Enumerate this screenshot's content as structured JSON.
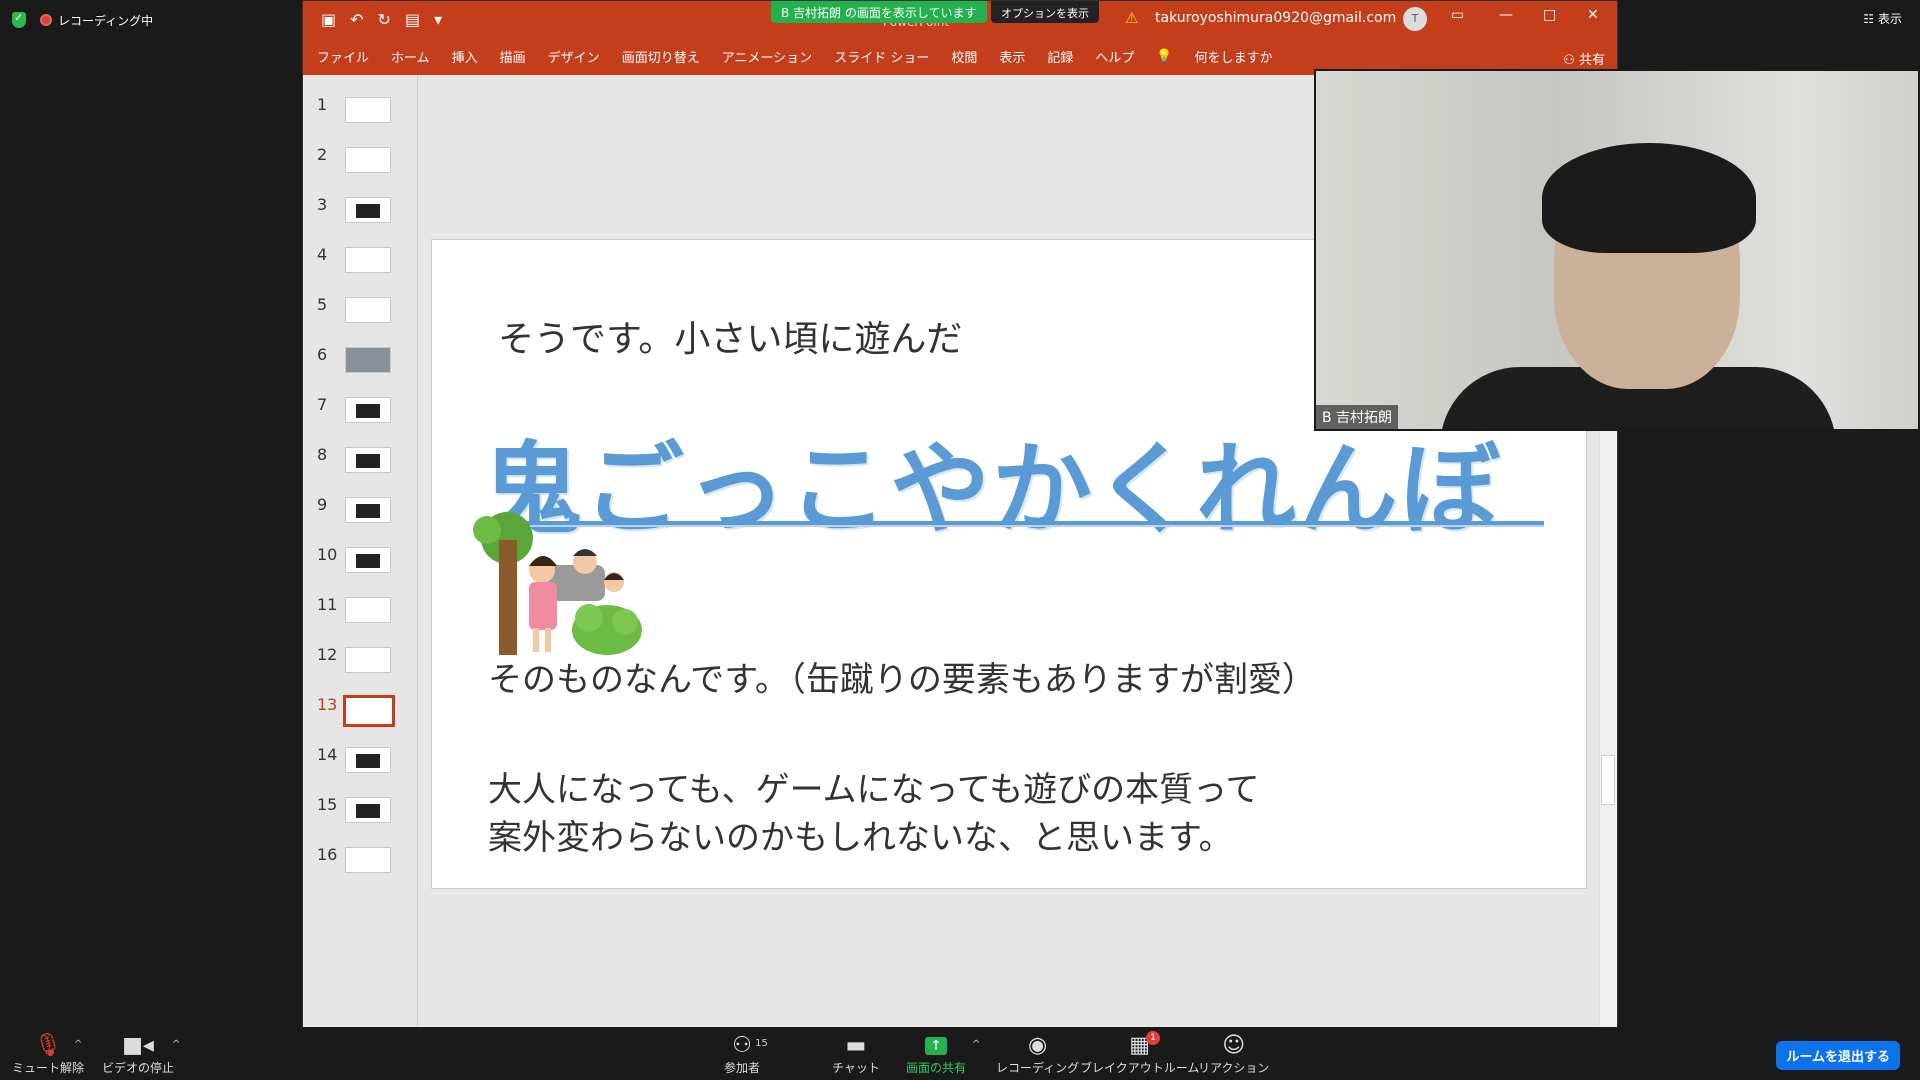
{
  "zoom": {
    "recording_label": "レコーディング中",
    "view_label": "表示",
    "share_banner": "B 吉村拓朗 の画面を表示しています",
    "options_label": "オプションを表示",
    "leave_label": "ルームを退出する",
    "toolbar": {
      "mute": "ミュート解除",
      "video": "ビデオの停止",
      "participants": "参加者",
      "participants_count": "15",
      "chat": "チャット",
      "share": "画面の共有",
      "record": "レコーディング",
      "breakout": "ブレイクアウトルーム",
      "breakout_badge": "1",
      "reaction": "リアクション"
    },
    "cam_name": "B 吉村拓朗"
  },
  "ppt": {
    "title_partial": "PowerPoint",
    "email": "takuroyoshimura0920@gmail.com",
    "user_initial": "T",
    "menu": [
      "ファイル",
      "ホーム",
      "挿入",
      "描画",
      "デザイン",
      "画面切り替え",
      "アニメーション",
      "スライド ショー",
      "校閲",
      "表示",
      "記録",
      "ヘルプ",
      "何をしますか"
    ],
    "share_label": "共有",
    "thumbnails": [
      "1",
      "2",
      "3",
      "4",
      "5",
      "6",
      "7",
      "8",
      "9",
      "10",
      "11",
      "12",
      "13",
      "14",
      "15",
      "16"
    ],
    "active_slide": "13",
    "slide": {
      "line1": "そうです。小さい頃に遊んだ",
      "big": "鬼ごっこやかくれんぼ",
      "line2": "そのものなんです。（缶蹴りの要素もありますが割愛）",
      "line3": "大人になっても、ゲームになっても遊びの本質って",
      "line4": "案外変わらないのかもしれないな、と思います。"
    }
  }
}
